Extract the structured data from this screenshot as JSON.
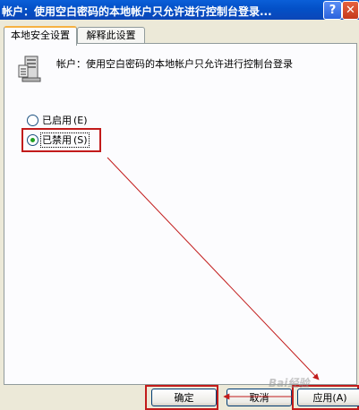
{
  "window": {
    "title": "帐户：使用空白密码的本地帐户只允许进行控制台登录...",
    "help_glyph": "?",
    "close_glyph": "✕"
  },
  "tabs": [
    {
      "label": "本地安全设置",
      "active": true
    },
    {
      "label": "解释此设置",
      "active": false
    }
  ],
  "policy": {
    "icon": "server-policy-icon",
    "description": "帐户：使用空白密码的本地帐户只允许进行控制台登录"
  },
  "options": [
    {
      "label": "已启用",
      "accel": "(E)",
      "selected": false
    },
    {
      "label": "已禁用",
      "accel": "(S)",
      "selected": true
    }
  ],
  "buttons": {
    "ok": "确定",
    "cancel": "取消",
    "apply": "应用(A)"
  },
  "watermark": "Bai经验",
  "annotation_color": "#c21b1b"
}
